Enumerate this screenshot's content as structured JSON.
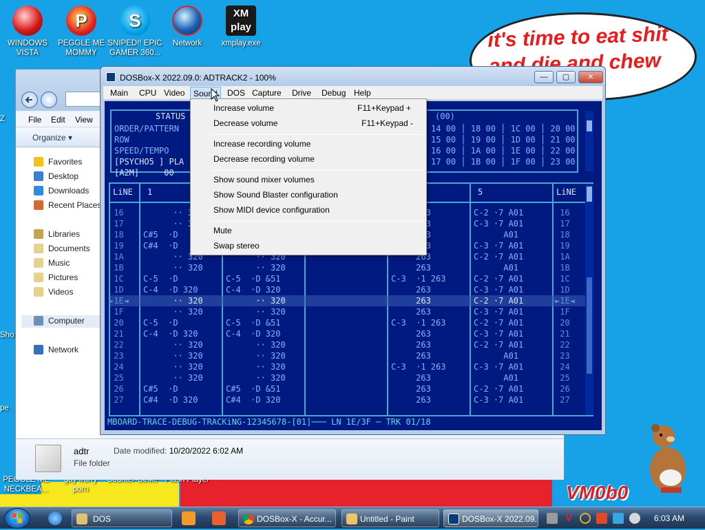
{
  "desktop": {
    "icons": [
      {
        "label": "WINDOWS\nVISTA",
        "icon": "red-sphere-icon"
      },
      {
        "label": "PEGGLE ME\nMOMMY",
        "icon": "peggle-icon"
      },
      {
        "label": "SNIPED!! EPIC\nGAMER 360...",
        "icon": "skype-icon"
      },
      {
        "label": "Network",
        "icon": "network-icon"
      },
      {
        "label": "xmplay.exe",
        "icon": "xmplay-icon"
      }
    ],
    "partial_labels": [
      "Z",
      "Sho",
      "pe",
      "PEGGLE ME\nNECKBEA...",
      "gay frurry\nporn",
      "Counter-Strike",
      "Flash Player"
    ],
    "bubble_text": "it's time to eat shit and die and chew",
    "watermark": "VM0b0"
  },
  "explorer": {
    "menu": [
      "File",
      "Edit",
      "View"
    ],
    "organize": "Organize ▾",
    "nav": [
      {
        "label": "Favorites",
        "group": true
      },
      {
        "label": "Desktop"
      },
      {
        "label": "Downloads"
      },
      {
        "label": "Recent Places"
      },
      {
        "label": "Libraries",
        "group": true
      },
      {
        "label": "Documents"
      },
      {
        "label": "Music"
      },
      {
        "label": "Pictures"
      },
      {
        "label": "Videos"
      },
      {
        "label": "Computer",
        "group": true
      },
      {
        "label": "Network",
        "group": true
      }
    ],
    "details": {
      "name": "adtr",
      "type": "File folder",
      "modified_label": "Date modified:",
      "modified_value": "10/20/2022 6:02 AM"
    }
  },
  "dosbox": {
    "title": "DOSBox-X 2022.09.0: ADTRACK2 - 100%",
    "buttons": {
      "minimize": "—",
      "maximize": "▢",
      "close": "✕"
    },
    "menu": [
      "Main",
      "CPU",
      "Video",
      "Sound",
      "DOS",
      "Capture",
      "Drive",
      "Debug",
      "Help"
    ],
    "active_menu": "Sound",
    "screen": {
      "status_title": "STATUS",
      "status_lines": [
        "ORDER/PATTERN",
        "ROW",
        "SPEED/TEMPO",
        "[PSYCHO5 ] PLA",
        "[A2M]     00"
      ],
      "order_header": "(00)",
      "order_rows": [
        "14 00 │ 18 00 │ 1C 00 │ 20 00",
        "15 00 │ 19 00 │ 1D 00 │ 21 00",
        "16 00 │ 1A 00 │ 1E 00 │ 22 00",
        "17 00 │ 1B 00 │ 1F 00 │ 23 00"
      ],
      "line_label": "LiNE",
      "channel_1": "1",
      "channel_5": "5",
      "row_numbers": [
        "16",
        "17",
        "18",
        "19",
        "1A",
        "1B",
        "1C",
        "1D",
        "1E",
        "1F",
        "20",
        "21",
        "22",
        "23",
        "24",
        "25",
        "26",
        "27"
      ],
      "highlight_row": "1E",
      "col1": [
        "      ·· 32",
        "      ·· 32",
        "C#5  ·D  ",
        "C#4  ·D  ",
        "      ·· 320",
        "      ·· 320",
        "C-5  ·D",
        "C-4  ·D 320",
        "      ·· 320",
        "      ·· 320",
        "C-5  ·D",
        "C-4  ·D 320",
        "      ·· 320",
        "      ·· 320",
        "      ·· 320",
        "      ·· 320",
        "C#5  ·D",
        "C#4  ·D 320"
      ],
      "col2": [
        "",
        "",
        "",
        "",
        "      ·· 320",
        "      ·· 320",
        "C-5  ·D &51",
        "C-4  ·D 320",
        "      ·· 320",
        "      ·· 320",
        "C-5  ·D &51",
        "C-4  ·D 320",
        "      ·· 320",
        "      ·· 320",
        "      ·· 320",
        "      ·· 320",
        "C#5  ·D &51",
        "C#4  ·D 320"
      ],
      "col4": [
        "     263",
        "     263",
        "     263",
        "     263",
        "     263",
        "     263",
        "C-3  ·1 263",
        "     263",
        "     263",
        "     263",
        "C-3  ·1 263",
        "     263",
        "     263",
        "     263",
        "C-3  ·1 263",
        "     263",
        "     263",
        "     263"
      ],
      "col5": [
        "C-2 ·7 A01",
        "C-3 ·7 A01",
        "      A01",
        "C-3 ·7 A01",
        "C-2 ·7 A01",
        "      A01",
        "C-2 ·7 A01",
        "C-3 ·7 A01",
        "C-2 ·7 A01",
        "C-3 ·7 A01",
        "C-2 ·7 A01",
        "C-3 ·7 A01",
        "C-2 ·7 A01",
        "      A01",
        "C-3 ·7 A01",
        "      A01",
        "C-2 ·7 A01",
        "C-3 ·7 A01"
      ],
      "bottom_status": "MBOARD-TRACE-DEBUG-TRACKiNG-12345678-[01]─── LN 1E/3F ─ TRK 01/18"
    }
  },
  "sound_menu": {
    "items": [
      {
        "label": "Increase volume",
        "shortcut": "F11+Keypad +"
      },
      {
        "label": "Decrease volume",
        "shortcut": "F11+Keypad -"
      },
      {
        "sep": true
      },
      {
        "label": "Increase recording volume",
        "shortcut": ""
      },
      {
        "label": "Decrease recording volume",
        "shortcut": ""
      },
      {
        "sep": true
      },
      {
        "label": "Show sound mixer volumes",
        "shortcut": ""
      },
      {
        "label": "Show Sound Blaster configuration",
        "shortcut": ""
      },
      {
        "label": "Show MIDI device configuration",
        "shortcut": ""
      },
      {
        "sep": true
      },
      {
        "label": "Mute",
        "shortcut": ""
      },
      {
        "label": "Swap stereo",
        "shortcut": ""
      }
    ]
  },
  "taskbar": {
    "buttons": [
      {
        "label": "DOS",
        "icon": "folder-icon"
      },
      {
        "label": "DOSBox-X - Accur...",
        "icon": "chrome-icon"
      },
      {
        "label": "Untitled - Paint",
        "icon": "paint-icon"
      },
      {
        "label": "DOSBox-X 2022.09...",
        "icon": "dosbox-icon",
        "active": true
      }
    ],
    "clock": "6:03 AM"
  }
}
